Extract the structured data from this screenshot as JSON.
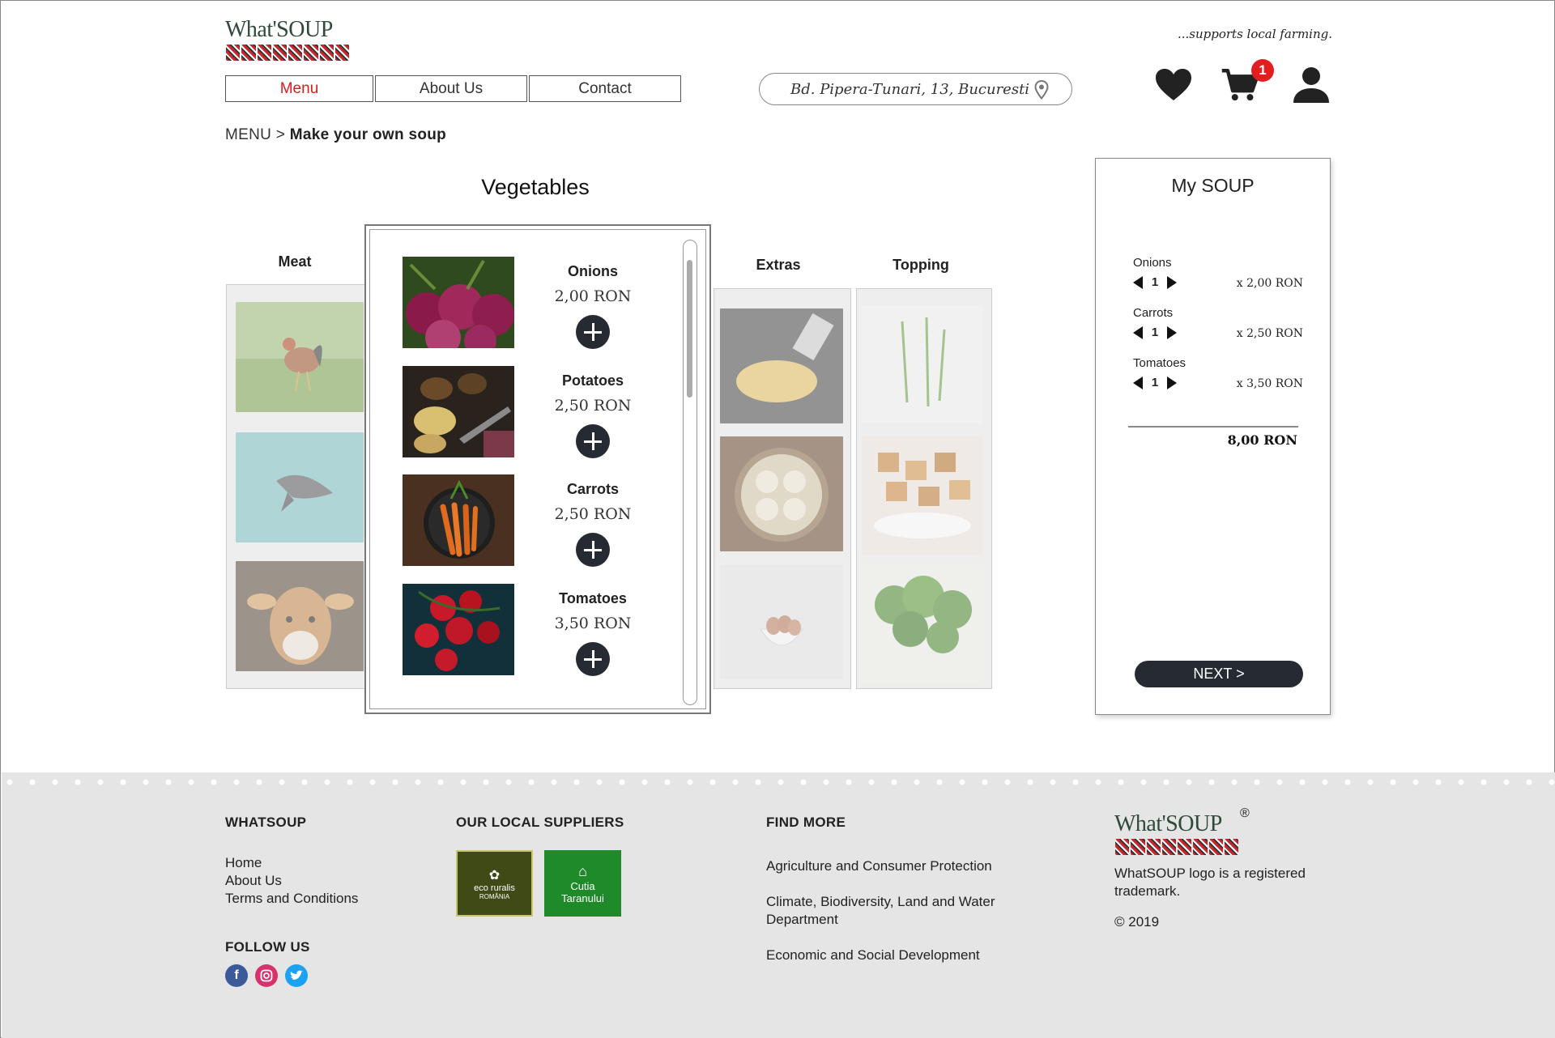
{
  "header": {
    "logo_text": "What'SOUP",
    "tagline": "...supports local farming.",
    "nav": [
      {
        "label": "Menu",
        "active": true
      },
      {
        "label": "About Us",
        "active": false
      },
      {
        "label": "Contact",
        "active": false
      }
    ],
    "address": "Bd. Pipera-Tunari, 13, Bucuresti",
    "cart_count": "1"
  },
  "breadcrumb": {
    "root": "MENU",
    "separator": ">",
    "current": "Make your own soup"
  },
  "categories": {
    "meat": "Meat",
    "vegetables": "Vegetables",
    "extras": "Extras",
    "topping": "Topping"
  },
  "vegetables": [
    {
      "name": "Onions",
      "price": "2,00 RON"
    },
    {
      "name": "Potatoes",
      "price": "2,50 RON"
    },
    {
      "name": "Carrots",
      "price": "2,50 RON"
    },
    {
      "name": "Tomatoes",
      "price": "3,50 RON"
    }
  ],
  "my_soup": {
    "title": "My SOUP",
    "items": [
      {
        "name": "Onions",
        "qty": "1",
        "price": "x  2,00 RON"
      },
      {
        "name": "Carrots",
        "qty": "1",
        "price": "x  2,50 RON"
      },
      {
        "name": "Tomatoes",
        "qty": "1",
        "price": "x  3,50 RON"
      }
    ],
    "total": "8,00 RON",
    "next_label": "NEXT >"
  },
  "footer": {
    "whatsoup_heading": "WHATSOUP",
    "links": [
      "Home",
      "About Us",
      "Terms and Conditions"
    ],
    "follow_heading": "FOLLOW US",
    "suppliers_heading": "OUR LOCAL SUPPLIERS",
    "suppliers": [
      "eco ruralis",
      "ROMÂNIA",
      "Cutia",
      "Taranului"
    ],
    "find_more_heading": "FIND MORE",
    "find_more": [
      "Agriculture and Consumer Protection",
      "Climate, Biodiversity, Land and Water Department",
      "Economic and Social Development"
    ],
    "logo_text": "What'SOUP",
    "registered": "®",
    "trademark_note": "WhatSOUP logo is a registered trademark.",
    "copyright": "© 2019"
  },
  "colors": {
    "accent_red": "#d81c1c",
    "dark_button": "#262b33",
    "footer_bg": "#e5e5e5"
  },
  "icons": [
    "location-pin-icon",
    "heart-icon",
    "cart-icon",
    "user-icon",
    "plus-icon",
    "arrow-left-icon",
    "arrow-right-icon",
    "facebook-icon",
    "instagram-icon",
    "twitter-icon"
  ]
}
